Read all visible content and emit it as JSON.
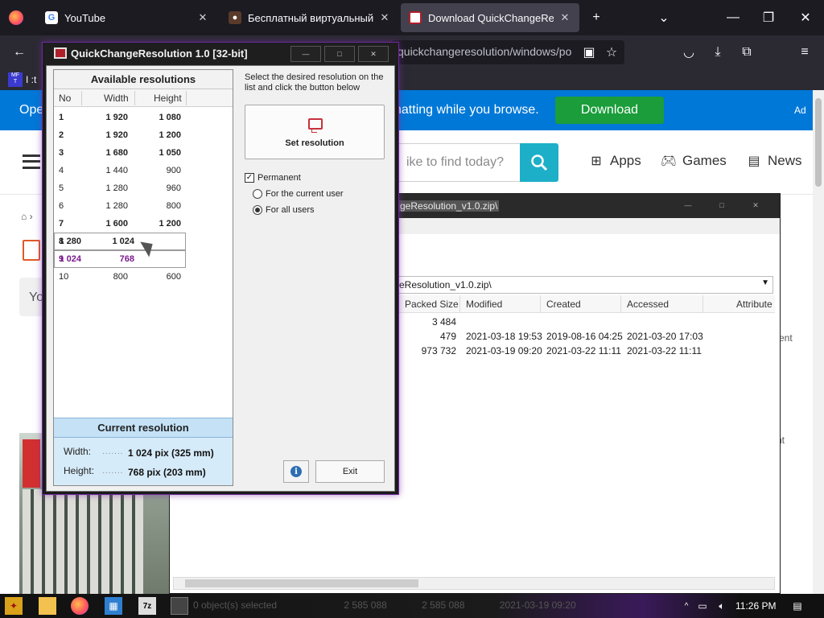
{
  "browser": {
    "tabs": [
      {
        "label": "YouTube",
        "icon": "google-icon",
        "active": false
      },
      {
        "label": "Бесплатный виртуальный но",
        "icon": "site-icon",
        "active": false
      },
      {
        "label": "Download QuickChangeResolu",
        "icon": "download-page-icon",
        "active": true
      }
    ],
    "new_tab": "+",
    "url": "quickchangeresolution/windows/po",
    "bookmark_label": "I :t"
  },
  "site": {
    "promo_left": "Ope",
    "promo_text": "hatting while you browse.",
    "promo_button": "Download",
    "ad_label": "Ad",
    "search_placeholder": "ike to find today?",
    "nav": {
      "apps": "Apps",
      "games": "Games",
      "news": "News"
    },
    "side_text_1": "Yo",
    "side_text_2": "ment",
    "side_text_3": "nt"
  },
  "sevenzip": {
    "title": "geResolution_v1.0.zip\\",
    "path": "eResolution_v1.0.zip\\",
    "columns": {
      "packed": "Packed Size",
      "modified": "Modified",
      "created": "Created",
      "accessed": "Accessed",
      "attributes": "Attribute"
    },
    "rows": [
      {
        "packed": "3 484",
        "modified": "",
        "created": "",
        "accessed": ""
      },
      {
        "packed": "479",
        "modified": "2021-03-18 19:53",
        "created": "2019-08-16 04:25",
        "accessed": "2021-03-20 17:03"
      },
      {
        "packed": "973 732",
        "modified": "2021-03-19 09:20",
        "created": "2021-03-22 11:11",
        "accessed": "2021-03-22 11:11"
      }
    ],
    "status": {
      "selected": "0 object(s) selected",
      "size1": "2 585 088",
      "size2": "2 585 088",
      "date": "2021-03-19 09:20"
    }
  },
  "qcr": {
    "title": "QuickChangeResolution 1.0  [32-bit]",
    "list_title": "Available resolutions",
    "col_no": "No",
    "col_width": "Width",
    "col_height": "Height",
    "resolutions": [
      {
        "no": "1",
        "width": "1 920",
        "height": "1 080",
        "bold": true
      },
      {
        "no": "2",
        "width": "1 920",
        "height": "1 200",
        "bold": true
      },
      {
        "no": "3",
        "width": "1 680",
        "height": "1 050",
        "bold": true
      },
      {
        "no": "4",
        "width": "1 440",
        "height": "900",
        "bold": false
      },
      {
        "no": "5",
        "width": "1 280",
        "height": "960",
        "bold": false
      },
      {
        "no": "6",
        "width": "1 280",
        "height": "800",
        "bold": false
      },
      {
        "no": "7",
        "width": "1 600",
        "height": "1 200",
        "bold": true
      },
      {
        "no": "8",
        "width": "1 280",
        "height": "1 024",
        "bold": true
      },
      {
        "no": "9",
        "width": "1 024",
        "height": "768",
        "bold": true
      },
      {
        "no": "10",
        "width": "800",
        "height": "600",
        "bold": false
      }
    ],
    "instructions": "Select the desired resolution on the list and click the button below",
    "set_button": "Set resolution",
    "permanent_label": "Permanent",
    "permanent_checked": true,
    "option_current_user": "For the current user",
    "option_all_users": "For all users",
    "selected_option": "all_users",
    "current_title": "Current resolution",
    "width_label": "Width:",
    "width_value": "1 024 pix   (325 mm)",
    "height_label": "Height:",
    "height_value": "768 pix   (203 mm)",
    "dots": ".......",
    "exit_button": "Exit",
    "info_glyph": "i"
  },
  "taskbar": {
    "clock": "11:26 PM",
    "zip_label": "7z"
  },
  "colors": {
    "tabbar": "#1c1b22",
    "promo": "#0078d7",
    "download_green": "#1a9d3a",
    "search_teal": "#1dafc8",
    "selected_row": "#7a1a8c",
    "current_panel": "#d6ebf9"
  }
}
